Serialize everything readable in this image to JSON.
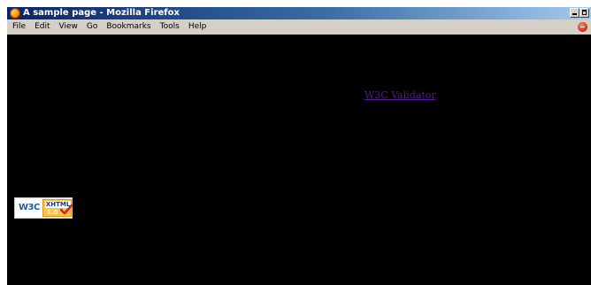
{
  "window": {
    "title": "A sample page - Mozilla Firefox",
    "app_icon": "firefox-icon",
    "controls": [
      "minimize-icon",
      "maximize-icon"
    ]
  },
  "menubar": {
    "items": [
      {
        "label": "File"
      },
      {
        "label": "Edit"
      },
      {
        "label": "View"
      },
      {
        "label": "Go"
      },
      {
        "label": "Bookmarks"
      },
      {
        "label": "Tools"
      },
      {
        "label": "Help"
      }
    ],
    "status_icon": "stop-icon"
  },
  "page": {
    "background": "#000000",
    "link": {
      "text": "W3C Validator",
      "color": "#551a8b"
    },
    "badge": {
      "w3c": "W3C",
      "xhtml": "XHTML",
      "version": "1.0",
      "check_icon": "checkmark-icon"
    }
  }
}
